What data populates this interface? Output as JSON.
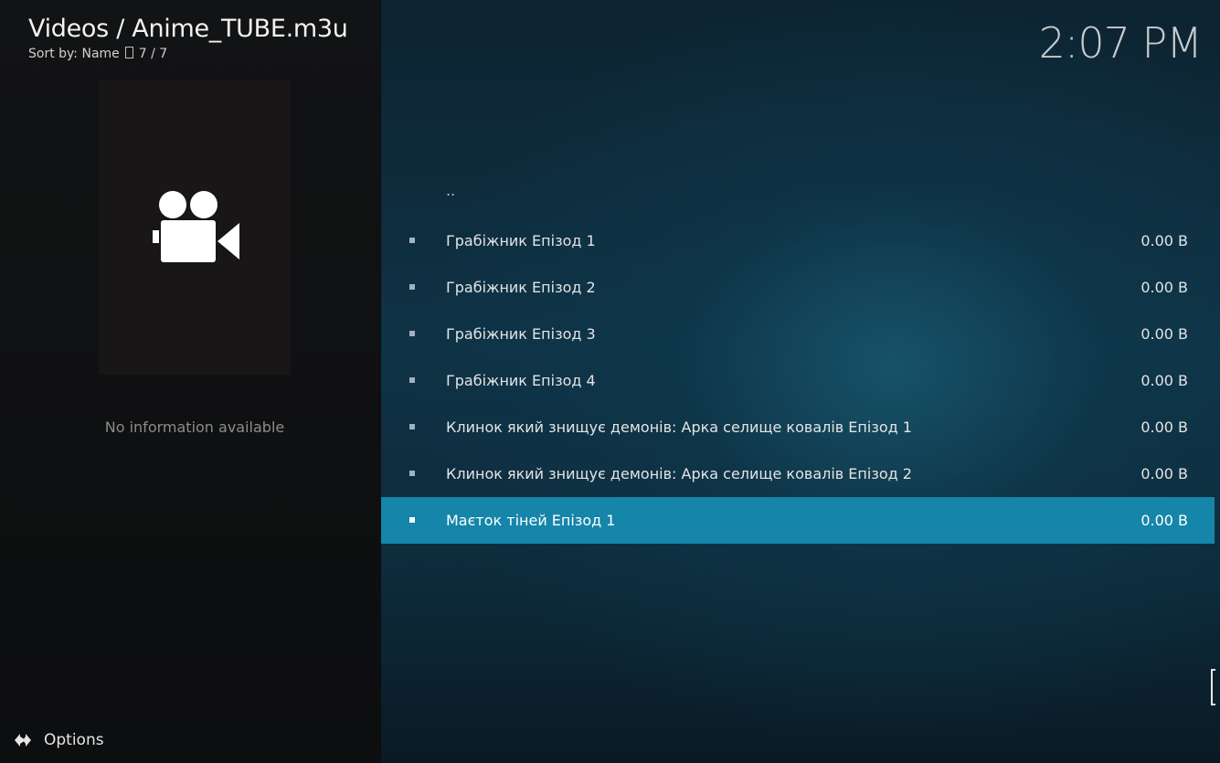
{
  "header": {
    "title": "Videos / Anime_TUBE.m3u",
    "sort_label": "Sort by: Name",
    "count": "7 / 7"
  },
  "clock": "2:07 PM",
  "info_panel": {
    "poster_icon": "video-camera-icon",
    "message": "No information available"
  },
  "footer": {
    "options_icon": "options-arrows-icon",
    "options_label": "Options"
  },
  "list": {
    "parent_label": "..",
    "items": [
      {
        "label": "Грабіжник Епізод 1",
        "size": "0.00 B"
      },
      {
        "label": "Грабіжник Епізод 2",
        "size": "0.00 B"
      },
      {
        "label": "Грабіжник Епізод 3",
        "size": "0.00 B"
      },
      {
        "label": "Грабіжник Епізод 4",
        "size": "0.00 B"
      },
      {
        "label": "Клинок який знищує демонів: Арка селище ковалів Епізод 1",
        "size": "0.00 B"
      },
      {
        "label": "Клинок який знищує демонів: Арка селище ковалів Епізод 2",
        "size": "0.00 B"
      },
      {
        "label": "Маєток тіней Епізод 1",
        "size": "0.00 B",
        "selected": true
      }
    ]
  },
  "colors": {
    "selection": "#1585a9",
    "background_right": "#0f3346",
    "background_left": "#121314"
  }
}
